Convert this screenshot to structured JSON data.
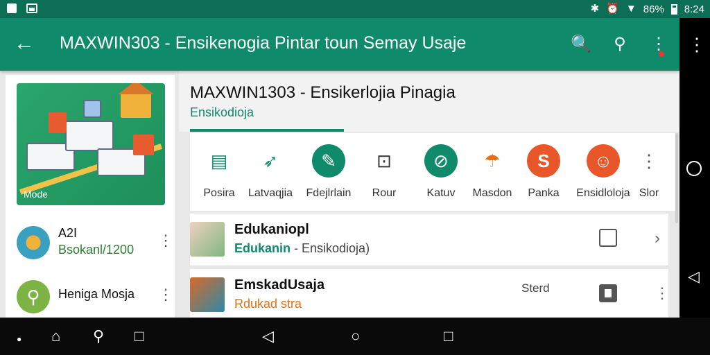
{
  "status_bar": {
    "battery": "86%",
    "time": "8:24"
  },
  "app_bar": {
    "title": "MAXWIN303 - Ensikenogia Pintar toun Semay Usaje",
    "back_icon": "arrow-left-icon",
    "search_pin_icon": "search-pin-icon",
    "search_icon": "search-icon",
    "more_icon": "more-vert-icon"
  },
  "side_panel": {
    "hero_label": "Mode",
    "items": [
      {
        "title": "A2I",
        "subtitle": "Bsokanl/1200"
      },
      {
        "title": "Heniga Mosja",
        "subtitle": ""
      }
    ]
  },
  "page": {
    "title": "MAXWIN1303 - Ensikerlojia Pinagia",
    "tab": "Ensikodioja"
  },
  "categories": [
    {
      "label": "Posira",
      "icon": "document-icon",
      "color": "#0f8a6a"
    },
    {
      "label": "Latvaqjia",
      "icon": "bird-icon",
      "color": "#0f8a6a"
    },
    {
      "label": "Fdejlrlain",
      "icon": "tools-icon",
      "color": "#0f8a6a"
    },
    {
      "label": "Rour",
      "icon": "frame-icon",
      "color": "#333333"
    },
    {
      "label": "Katuv",
      "icon": "compass-icon",
      "color": "#0f8a6a"
    },
    {
      "label": "Masdon",
      "icon": "umbrella-icon",
      "color": "#e0711a"
    },
    {
      "label": "Panka",
      "icon": "s-badge-icon",
      "color": "#e8562a"
    },
    {
      "label": "Ensidloloja",
      "icon": "person-icon",
      "color": "#e8562a"
    },
    {
      "label": "Slor",
      "icon": "more-vert-icon",
      "color": "#555555"
    }
  ],
  "list": [
    {
      "title": "Edukaniopl",
      "sub_green": "Edukanin",
      "sub_rest": " - Ensikodioja)"
    },
    {
      "title": "EmskadUsaja",
      "sub_orange": "Rdukad stra",
      "status": "Sterd"
    }
  ]
}
